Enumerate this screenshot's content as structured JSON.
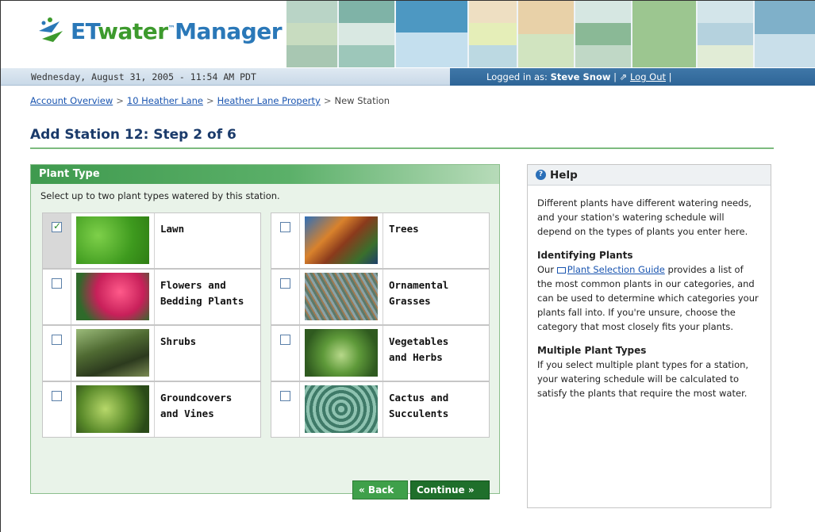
{
  "header": {
    "logo_prefix": "ET",
    "logo_mid": "water",
    "logo_suffix": "Manager",
    "date_line": "Wednesday, August 31, 2005 - 11:54 AM PDT",
    "logged_in_label": "Logged in as:",
    "user_name": "Steve Snow",
    "logout_label": "Log Out"
  },
  "breadcrumb": {
    "items": [
      "Account Overview",
      "10 Heather Lane",
      "Heather Lane Property"
    ],
    "current": "New Station"
  },
  "page_title": "Add Station 12: Step 2 of 6",
  "plant_panel": {
    "title": "Plant Type",
    "instruction": "Select up to two plant types watered by this station.",
    "items": [
      {
        "name_line1": "Lawn",
        "name_line2": "",
        "checked": true,
        "icon": "lawn-photo"
      },
      {
        "name_line1": "Trees",
        "name_line2": "",
        "checked": false,
        "icon": "trees-photo"
      },
      {
        "name_line1": "Flowers and",
        "name_line2": "Bedding Plants",
        "checked": false,
        "icon": "flowers-photo"
      },
      {
        "name_line1": "Ornamental",
        "name_line2": "Grasses",
        "checked": false,
        "icon": "grasses-photo"
      },
      {
        "name_line1": "Shrubs",
        "name_line2": "",
        "checked": false,
        "icon": "shrubs-photo"
      },
      {
        "name_line1": "Vegetables",
        "name_line2": "and Herbs",
        "checked": false,
        "icon": "vegetables-photo"
      },
      {
        "name_line1": "Groundcovers",
        "name_line2": "and Vines",
        "checked": false,
        "icon": "groundcovers-photo"
      },
      {
        "name_line1": "Cactus and",
        "name_line2": "Succulents",
        "checked": false,
        "icon": "cactus-photo"
      }
    ],
    "back_label": "« Back",
    "continue_label": "Continue »"
  },
  "help": {
    "title": "Help",
    "intro": "Different plants have different watering needs, and your station's watering schedule will depend on the types of plants you enter here.",
    "section1_title": "Identifying Plants",
    "section1_pre": "Our ",
    "section1_link": "Plant Selection Guide",
    "section1_post": " provides a list of the most common plants in our categories, and can be used to determine which categories your plants fall into. If you're unsure, choose the category that most closely fits your plants.",
    "section2_title": "Multiple Plant Types",
    "section2_text": "If you select multiple plant types for a station, your watering schedule will be calculated to satisfy the plants that require the most water."
  },
  "colors": {
    "brand_blue": "#2a78b8",
    "brand_green": "#3d9a2d",
    "panel_green": "#3f9a4e",
    "link_blue": "#1a55b0"
  }
}
